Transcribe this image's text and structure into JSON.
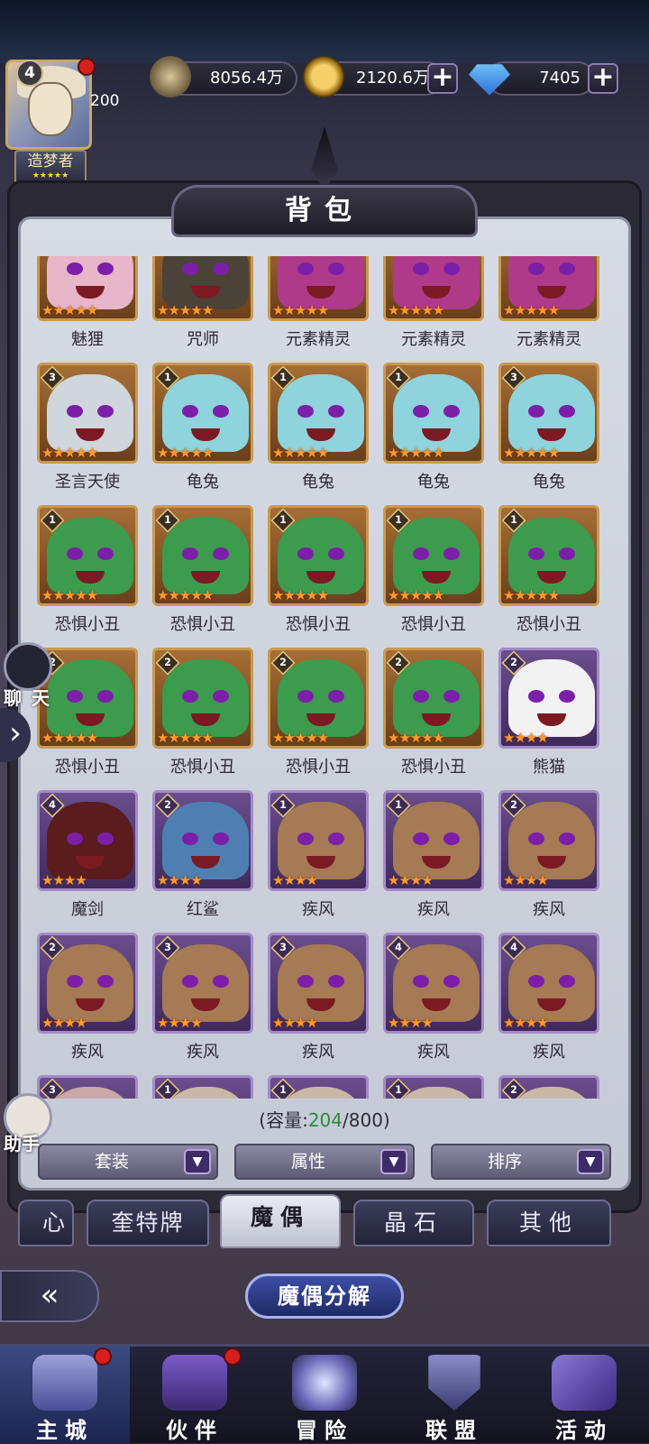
{
  "player": {
    "level": "4",
    "vip_text": "200",
    "title": "造梦者",
    "title_stars": "★★★★★"
  },
  "resources": {
    "power": "8056.4万",
    "gold": "2120.6万",
    "diamond": "7405"
  },
  "panel_title": "背包",
  "items": [
    {
      "name": "魅狸",
      "stars": "★★★★★",
      "frame": "gold",
      "art": "#e7b6c8"
    },
    {
      "name": "咒师",
      "stars": "★★★★★",
      "frame": "gold",
      "art": "#4b4238"
    },
    {
      "name": "元素精灵",
      "stars": "★★★★★",
      "frame": "gold",
      "art": "#b03a8a"
    },
    {
      "name": "元素精灵",
      "stars": "★★★★★",
      "frame": "gold",
      "art": "#b03a8a"
    },
    {
      "name": "元素精灵",
      "stars": "★★★★★",
      "frame": "gold",
      "art": "#b03a8a"
    },
    {
      "name": "圣言天使",
      "badge": "3",
      "stars": "★★★★★",
      "frame": "gold",
      "art": "#cfd6dc"
    },
    {
      "name": "龟兔",
      "badge": "1",
      "stars": "★★★★★",
      "frame": "gold",
      "art": "#8fd3dc"
    },
    {
      "name": "龟兔",
      "badge": "1",
      "stars": "★★★★★",
      "frame": "gold",
      "art": "#8fd3dc"
    },
    {
      "name": "龟兔",
      "badge": "1",
      "stars": "★★★★★",
      "frame": "gold",
      "art": "#8fd3dc"
    },
    {
      "name": "龟兔",
      "badge": "3",
      "stars": "★★★★★",
      "frame": "gold",
      "art": "#8fd3dc"
    },
    {
      "name": "恐惧小丑",
      "badge": "1",
      "stars": "★★★★★",
      "frame": "gold",
      "art": "#3d9b4e"
    },
    {
      "name": "恐惧小丑",
      "badge": "1",
      "stars": "★★★★★",
      "frame": "gold",
      "art": "#3d9b4e"
    },
    {
      "name": "恐惧小丑",
      "badge": "1",
      "stars": "★★★★★",
      "frame": "gold",
      "art": "#3d9b4e"
    },
    {
      "name": "恐惧小丑",
      "badge": "1",
      "stars": "★★★★★",
      "frame": "gold",
      "art": "#3d9b4e"
    },
    {
      "name": "恐惧小丑",
      "badge": "1",
      "stars": "★★★★★",
      "frame": "gold",
      "art": "#3d9b4e"
    },
    {
      "name": "恐惧小丑",
      "badge": "2",
      "stars": "★★★★★",
      "frame": "gold",
      "art": "#3d9b4e"
    },
    {
      "name": "恐惧小丑",
      "badge": "2",
      "stars": "★★★★★",
      "frame": "gold",
      "art": "#3d9b4e"
    },
    {
      "name": "恐惧小丑",
      "badge": "2",
      "stars": "★★★★★",
      "frame": "gold",
      "art": "#3d9b4e"
    },
    {
      "name": "恐惧小丑",
      "badge": "2",
      "stars": "★★★★★",
      "frame": "gold",
      "art": "#3d9b4e"
    },
    {
      "name": "熊猫",
      "badge": "2",
      "stars": "★★★★",
      "frame": "purple",
      "art": "#f2f2f2"
    },
    {
      "name": "魔剑",
      "badge": "4",
      "stars": "★★★★",
      "frame": "purple",
      "art": "#5a1c1c"
    },
    {
      "name": "红鲨",
      "badge": "2",
      "stars": "★★★★",
      "frame": "purple",
      "art": "#4f7fb2"
    },
    {
      "name": "疾风",
      "badge": "1",
      "stars": "★★★★",
      "frame": "purple",
      "art": "#a57a55"
    },
    {
      "name": "疾风",
      "badge": "1",
      "stars": "★★★★",
      "frame": "purple",
      "art": "#a57a55"
    },
    {
      "name": "疾风",
      "badge": "2",
      "stars": "★★★★",
      "frame": "purple",
      "art": "#a57a55"
    },
    {
      "name": "疾风",
      "badge": "2",
      "stars": "★★★★",
      "frame": "purple",
      "art": "#a57a55"
    },
    {
      "name": "疾风",
      "badge": "3",
      "stars": "★★★★",
      "frame": "purple",
      "art": "#a57a55"
    },
    {
      "name": "疾风",
      "badge": "3",
      "stars": "★★★★",
      "frame": "purple",
      "art": "#a57a55"
    },
    {
      "name": "疾风",
      "badge": "4",
      "stars": "★★★★",
      "frame": "purple",
      "art": "#a57a55"
    },
    {
      "name": "疾风",
      "badge": "4",
      "stars": "★★★★",
      "frame": "purple",
      "art": "#a57a55"
    },
    {
      "name": "",
      "badge": "3",
      "stars": "",
      "frame": "purple",
      "art": "#c9a8a8"
    },
    {
      "name": "",
      "badge": "1",
      "stars": "",
      "frame": "purple",
      "art": "#c9b8a8"
    },
    {
      "name": "",
      "badge": "1",
      "stars": "",
      "frame": "purple",
      "art": "#c9b8a8"
    },
    {
      "name": "",
      "badge": "1",
      "stars": "",
      "frame": "purple",
      "art": "#c9b8a8"
    },
    {
      "name": "",
      "badge": "2",
      "stars": "",
      "frame": "purple",
      "art": "#c9b8a8"
    }
  ],
  "capacity": {
    "prefix": "(容量:",
    "used": "204",
    "suffix": "/800)"
  },
  "filters": [
    "套装",
    "属性",
    "排序"
  ],
  "tabs": [
    "心",
    "奎特牌",
    "魔偶",
    "晶石",
    "其他"
  ],
  "decompose_label": "魔偶分解",
  "side": {
    "chat": "聊 天",
    "assistant": "助手"
  },
  "nav": [
    "主城",
    "伙伴",
    "冒险",
    "联盟",
    "活动"
  ]
}
